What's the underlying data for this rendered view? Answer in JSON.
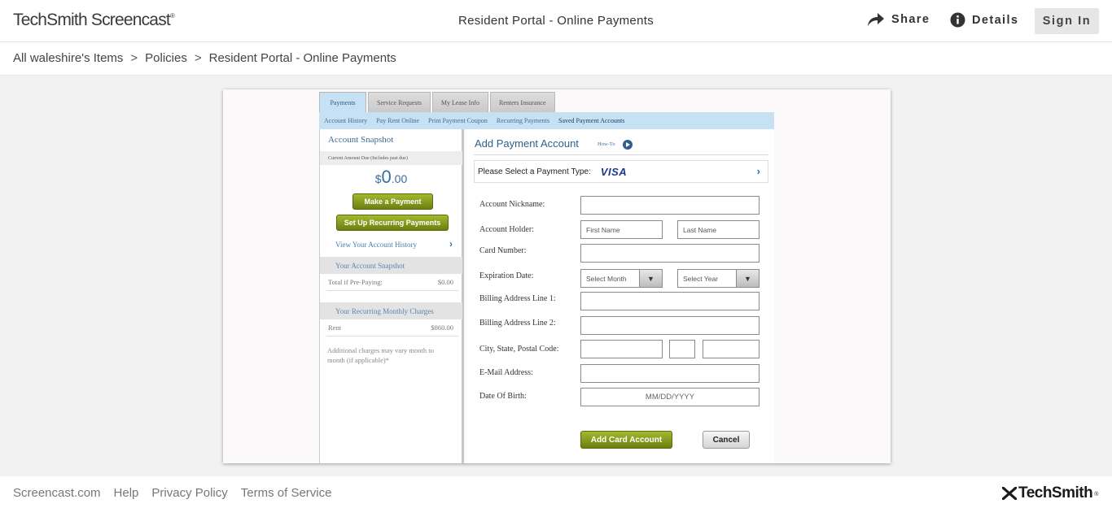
{
  "header": {
    "logo_text": "TechSmith Screencast",
    "logo_mark": "®",
    "title": "Resident Portal - Online Payments",
    "share_label": "Share",
    "details_label": "Details",
    "signin_label": "Sign In"
  },
  "breadcrumb": {
    "items": [
      "All waleshire's Items",
      "Policies",
      "Resident Portal - Online Payments"
    ],
    "separator": ">"
  },
  "portal": {
    "tabs": [
      "Payments",
      "Service Requests",
      "My Lease Info",
      "Renters Insurance"
    ],
    "subnav": [
      "Account History",
      "Pay Rent Online",
      "Print Payment Coupon",
      "Recurring Payments",
      "Saved Payment Accounts"
    ],
    "snapshot": {
      "title": "Account Snapshot",
      "amount_caption": "Current Amount Due (Includes past due)",
      "amount_currency": "$",
      "amount_whole": "0",
      "amount_cents": ".00",
      "make_payment": "Make a Payment",
      "setup_recurring": "Set Up Recurring Payments",
      "history_link": "View Your Account History",
      "your_snapshot_heading": "Your Account Snapshot",
      "prepay_label": "Total if Pre-Paying:",
      "prepay_value": "$0.00",
      "recurring_heading": "Your Recurring Monthly Charges",
      "rent_label": "Rent",
      "rent_value": "$860.00",
      "note": "Additional charges may vary month to month (if applicable)*"
    },
    "form": {
      "title": "Add Payment Account",
      "howto": "How-To",
      "payment_type_label": "Please Select a Payment Type:",
      "payment_type_value": "VISA",
      "labels": {
        "nickname": "Account Nickname:",
        "holder": "Account Holder:",
        "card_number": "Card Number:",
        "expiration": "Expiration Date:",
        "billing1": "Billing Address Line 1:",
        "billing2": "Billing Address Line 2:",
        "city_state_zip": "City, State, Postal Code:",
        "email": "E-Mail Address:",
        "dob": "Date Of Birth:"
      },
      "placeholders": {
        "first_name": "First Name",
        "last_name": "Last Name",
        "dob": "MM/DD/YYYY"
      },
      "selects": {
        "month": "Select Month",
        "year": "Select Year"
      },
      "submit_label": "Add Card Account",
      "cancel_label": "Cancel"
    }
  },
  "footer": {
    "links": [
      "Screencast.com",
      "Help",
      "Privacy Policy",
      "Terms of Service"
    ],
    "brand": "TechSmith",
    "brand_mark": "®"
  }
}
